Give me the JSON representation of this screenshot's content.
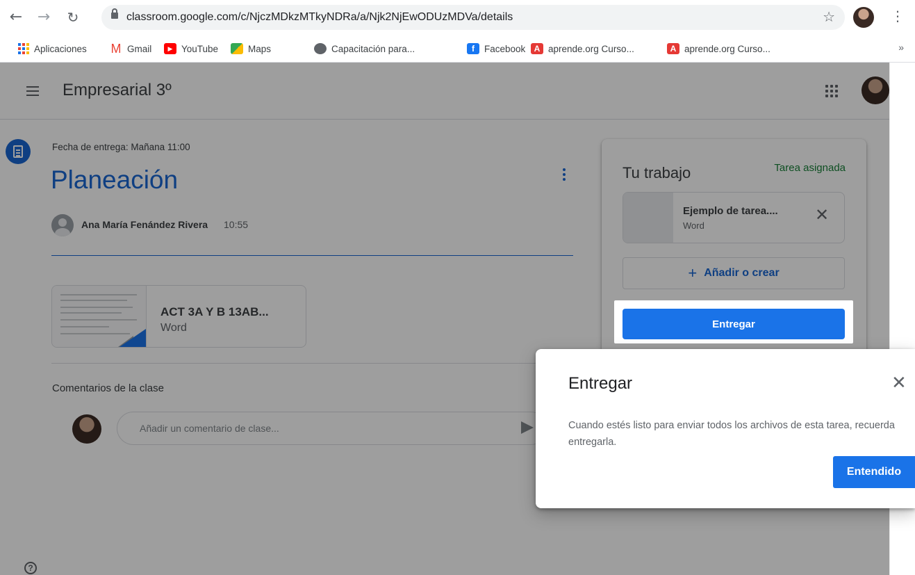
{
  "browser": {
    "url": "classroom.google.com/c/NjczMDkzMTkyNDRa/a/Njk2NjEwODUzMDVa/details",
    "bookmarks": [
      {
        "label": "Aplicaciones"
      },
      {
        "label": "Gmail"
      },
      {
        "label": "YouTube"
      },
      {
        "label": "Maps"
      },
      {
        "label": "Capacitación para..."
      },
      {
        "label": "Facebook"
      },
      {
        "label": "aprende.org Curso..."
      },
      {
        "label": "aprende.org Curso..."
      }
    ],
    "more": "»"
  },
  "header": {
    "course_title": "Empresarial 3º"
  },
  "assignment": {
    "due": "Fecha de entrega: Mañana 11:00",
    "title": "Planeación",
    "author": "Ana María Fenández Rivera",
    "time": "10:55",
    "attachment": {
      "title": "ACT 3A Y B 13AB...",
      "type": "Word"
    },
    "comments_label": "Comentarios de la clase",
    "comment_placeholder": "Añadir un comentario de clase..."
  },
  "work": {
    "title": "Tu trabajo",
    "status": "Tarea asignada",
    "file_name": "Ejemplo de tarea....",
    "file_type": "Word",
    "add_label": "Añadir o crear",
    "submit_label": "Entregar",
    "status_color": "#188038",
    "accent": "#1a73e8"
  },
  "popover": {
    "title": "Entregar",
    "body": "Cuando estés listo para enviar todos los archivos de esta tarea, recuerda entregarla.",
    "ok_label": "Entendido"
  }
}
